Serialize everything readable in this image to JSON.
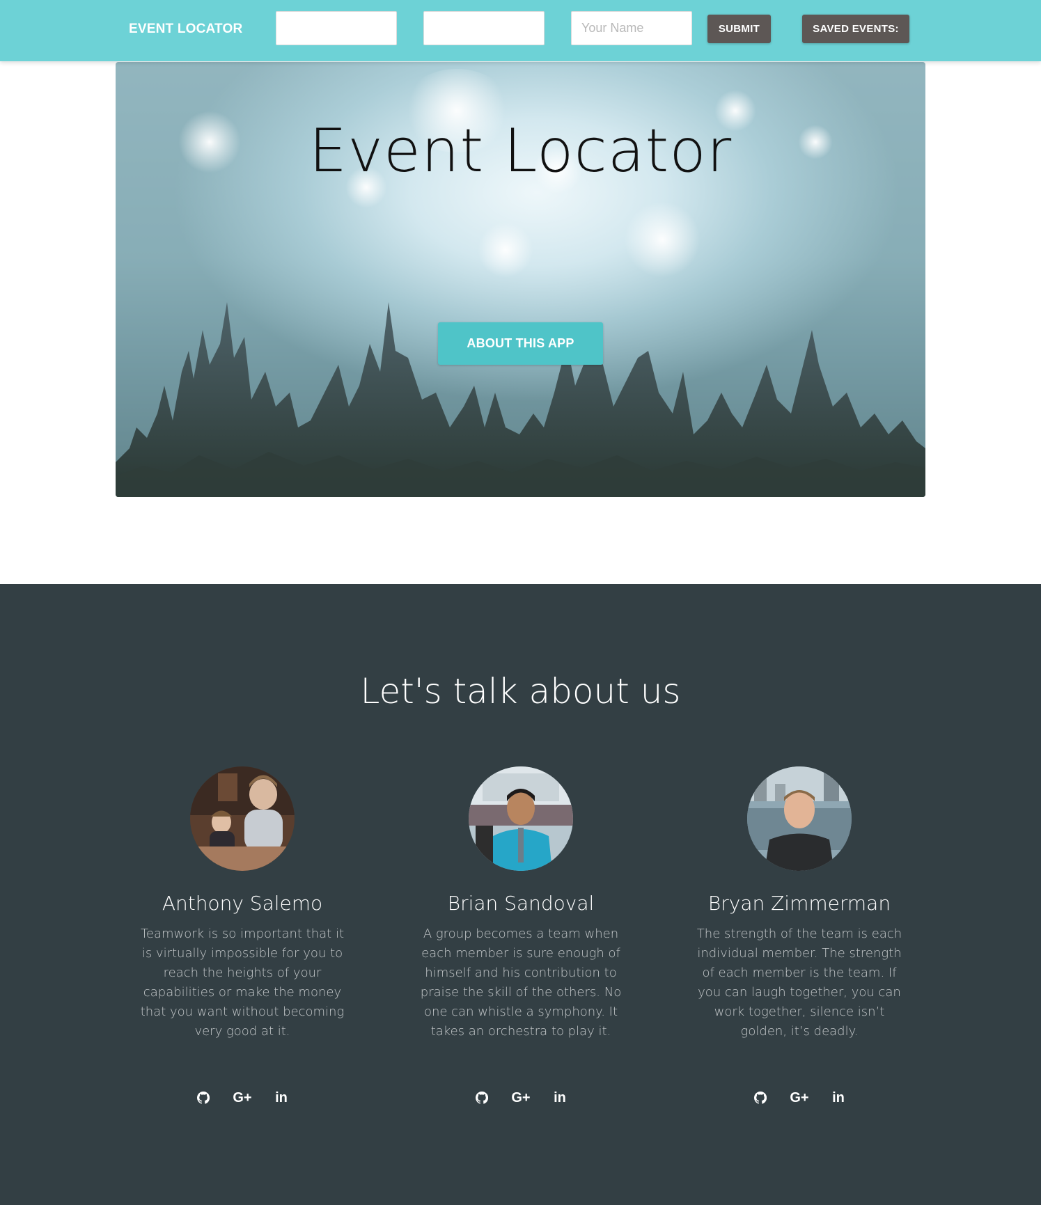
{
  "navbar": {
    "brand": "EVENT LOCATOR",
    "input1": {
      "value": "",
      "placeholder": ""
    },
    "input2": {
      "value": "",
      "placeholder": ""
    },
    "input3": {
      "value": "",
      "placeholder": "Your Name"
    },
    "submit_label": "SUBMIT",
    "saved_events_label": "SAVED EVENTS:",
    "colors": {
      "bar": "#6dd2d6",
      "button": "#5d5755"
    }
  },
  "hero": {
    "title": "Event Locator",
    "button_label": "ABOUT THIS APP",
    "colors": {
      "button": "#4fc4c8"
    }
  },
  "about": {
    "title": "Let's talk about us",
    "background": "#333f44",
    "members": [
      {
        "name": "Anthony Salemo",
        "bio": "Teamwork is so important that it is virtually impossible for you to reach the heights of your capabilities or make the money that you want without becoming very good at it.",
        "socials": [
          "github-icon",
          "google-plus-icon",
          "linkedin-icon"
        ]
      },
      {
        "name": "Brian Sandoval",
        "bio": "A group becomes a team when each member is sure enough of himself and his contribution to praise the skill of the others. No one can whistle a symphony. It takes an orchestra to play it.",
        "socials": [
          "github-icon",
          "google-plus-icon",
          "linkedin-icon"
        ]
      },
      {
        "name": "Bryan Zimmerman",
        "bio": "The strength of the team is each individual member. The strength of each member is the team. If you can laugh together, you can work together, silence isn’t golden, it’s deadly.",
        "socials": [
          "github-icon",
          "google-plus-icon",
          "linkedin-icon"
        ]
      }
    ]
  }
}
